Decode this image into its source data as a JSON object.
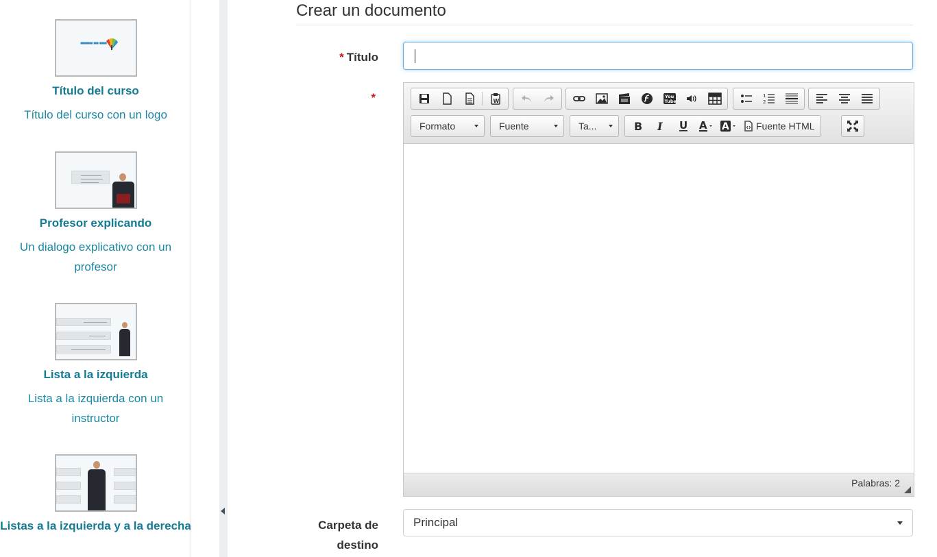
{
  "sidebar": {
    "templates": [
      {
        "name": "Título del curso",
        "description": "Título del curso con un logo",
        "thumb_icon": "course-title-logo-thumbnail"
      },
      {
        "name": "Profesor explicando",
        "description": "Un dialogo explicativo con un profesor",
        "thumb_icon": "teacher-explaining-thumbnail"
      },
      {
        "name": "Lista a la izquierda",
        "description": "Lista a la izquierda con un instructor",
        "thumb_icon": "left-list-thumbnail"
      },
      {
        "name": "Listas a la izquierda y a la derecha",
        "description": "",
        "thumb_icon": "left-right-lists-thumbnail"
      }
    ]
  },
  "main": {
    "title": "Crear un documento",
    "form": {
      "required_mark": "*",
      "titulo_label": "Título",
      "titulo_value": "",
      "carpeta_label": "Carpeta de destino",
      "carpeta_value": "Principal"
    },
    "editor": {
      "format_label": "Formato",
      "font_label": "Fuente",
      "size_label": "Ta...",
      "source_label": "Fuente HTML",
      "word_count": "Palabras: 2"
    }
  },
  "colors": {
    "link": "#137b94",
    "required": "#c8161d",
    "focus": "#66afe9"
  }
}
